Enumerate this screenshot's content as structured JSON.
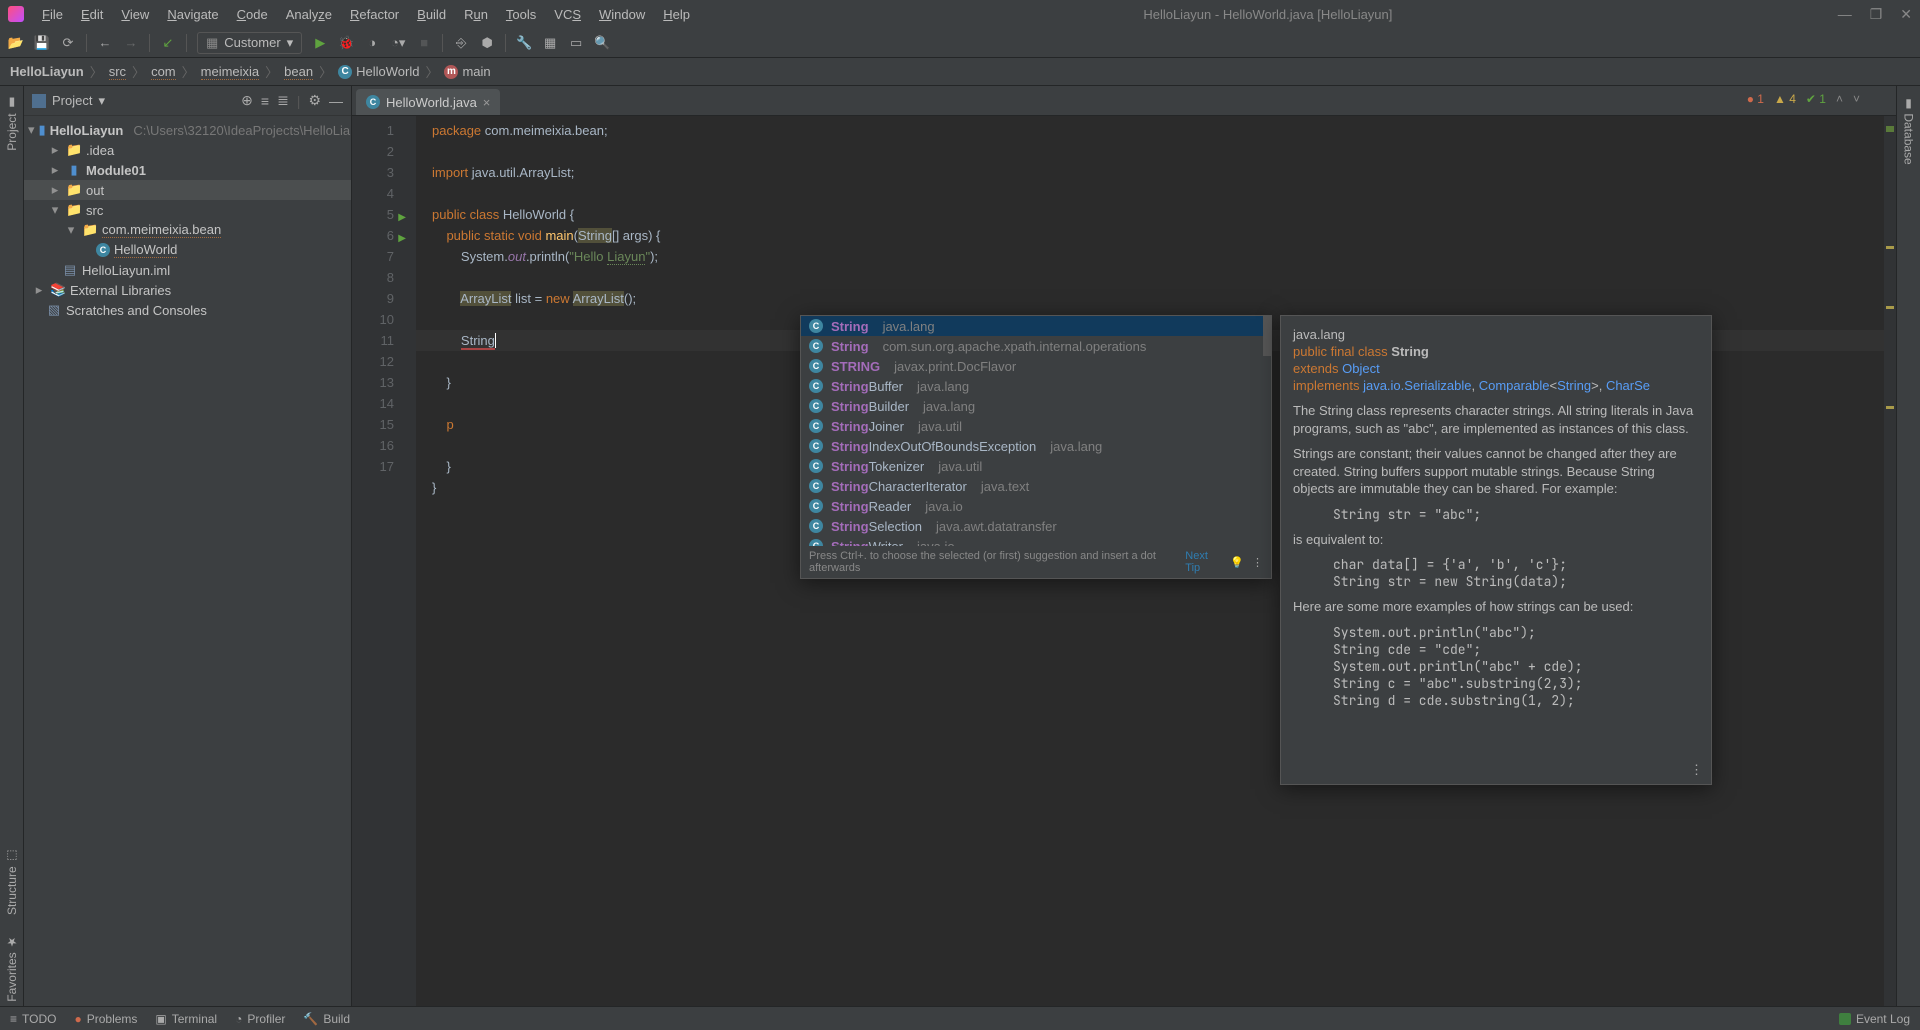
{
  "window_title": "HelloLiayun - HelloWorld.java [HelloLiayun]",
  "menu": [
    "File",
    "Edit",
    "View",
    "Navigate",
    "Code",
    "Analyze",
    "Refactor",
    "Build",
    "Run",
    "Tools",
    "VCS",
    "Window",
    "Help"
  ],
  "run_config": "Customer",
  "breadcrumbs": [
    "HelloLiayun",
    "src",
    "com",
    "meimeixia",
    "bean",
    "HelloWorld",
    "main"
  ],
  "project_dropdown": "Project",
  "tree": {
    "root": "HelloLiayun",
    "root_path": "C:\\Users\\32120\\IdeaProjects\\HelloLia",
    "idea": ".idea",
    "module": "Module01",
    "out": "out",
    "src": "src",
    "pkg": "com.meimeixia.bean",
    "cls": "HelloWorld",
    "iml": "HelloLiayun.iml",
    "ext": "External Libraries",
    "scratch": "Scratches and Consoles"
  },
  "tab_name": "HelloWorld.java",
  "inspections": {
    "errors": "1",
    "warnings": "4",
    "typos": "1"
  },
  "code": {
    "l1a": "package ",
    "l1b": "com.meimeixia.bean;",
    "l3a": "import ",
    "l3b": "java.util.ArrayList;",
    "l5a": "public class ",
    "l5b": "HelloWorld",
    "l5c": " {",
    "l6a": "    public static void ",
    "l6b": "main",
    "l6c": "(",
    "l6d": "String",
    "l6e": "[] args) {",
    "l7a": "        System.",
    "l7b": "out",
    "l7c": ".println(",
    "l7d": "\"Hello ",
    "l7e": "Liayun",
    "l7f": "\"",
    "l7g": ");",
    "l9a": "        ",
    "l9b": "ArrayList",
    "l9c": " list = ",
    "l9d": "new ",
    "l9e": "ArrayList",
    "l9f": "();",
    "l11a": "        ",
    "l11b": "String",
    "l12a": "    }",
    "l14a": "    p",
    "l16a": "    }",
    "l17a": "}"
  },
  "completion": {
    "items": [
      {
        "match": "String",
        "rest": "",
        "pkg": "java.lang"
      },
      {
        "match": "String",
        "rest": "",
        "pkg": "com.sun.org.apache.xpath.internal.operations"
      },
      {
        "match": "STRING",
        "rest": "",
        "pkg": "javax.print.DocFlavor"
      },
      {
        "match": "String",
        "rest": "Buffer",
        "pkg": "java.lang"
      },
      {
        "match": "String",
        "rest": "Builder",
        "pkg": "java.lang"
      },
      {
        "match": "String",
        "rest": "Joiner",
        "pkg": "java.util"
      },
      {
        "match": "String",
        "rest": "IndexOutOfBoundsException",
        "pkg": "java.lang"
      },
      {
        "match": "String",
        "rest": "Tokenizer",
        "pkg": "java.util"
      },
      {
        "match": "String",
        "rest": "CharacterIterator",
        "pkg": "java.text"
      },
      {
        "match": "String",
        "rest": "Reader",
        "pkg": "java.io"
      },
      {
        "match": "String",
        "rest": "Selection",
        "pkg": "java.awt.datatransfer"
      },
      {
        "match": "String",
        "rest": "Writer",
        "pkg": "java.io"
      }
    ],
    "hint": "Press Ctrl+. to choose the selected (or first) suggestion and insert a dot afterwards",
    "next_tip": "Next Tip"
  },
  "doc": {
    "pkg": "java.lang",
    "decl1a": "public final class ",
    "decl1b": "String",
    "decl2a": "extends ",
    "decl2b": "Object",
    "decl3a": "implements ",
    "decl3b": "java.io.Serializable",
    "decl3c": ", ",
    "decl3d": "Comparable",
    "decl3e": "<",
    "decl3f": "String",
    "decl3g": ">, ",
    "decl3h": "CharSe",
    "p1": "The String class represents character strings. All string literals in Java programs, such as \"abc\", are implemented as instances of this class.",
    "p2": "Strings are constant; their values cannot be changed after they are created. String buffers support mutable strings. Because String objects are immutable they can be shared. For example:",
    "ex1": "String str = \"abc\";",
    "p3": "is equivalent to:",
    "ex2": "char data[] = {'a', 'b', 'c'};\nString str = new String(data);",
    "p4": "Here are some more examples of how strings can be used:",
    "ex3": "System.out.println(\"abc\");\nString cde = \"cde\";\nSystem.out.println(\"abc\" + cde);\nString c = \"abc\".substring(2,3);\nString d = cde.substring(1, 2);"
  },
  "left_rail": {
    "project": "Project",
    "structure": "Structure",
    "favorites": "Favorites"
  },
  "right_rail": {
    "database": "Database"
  },
  "status": {
    "todo": "TODO",
    "problems": "Problems",
    "terminal": "Terminal",
    "profiler": "Profiler",
    "build": "Build",
    "event_log": "Event Log"
  }
}
